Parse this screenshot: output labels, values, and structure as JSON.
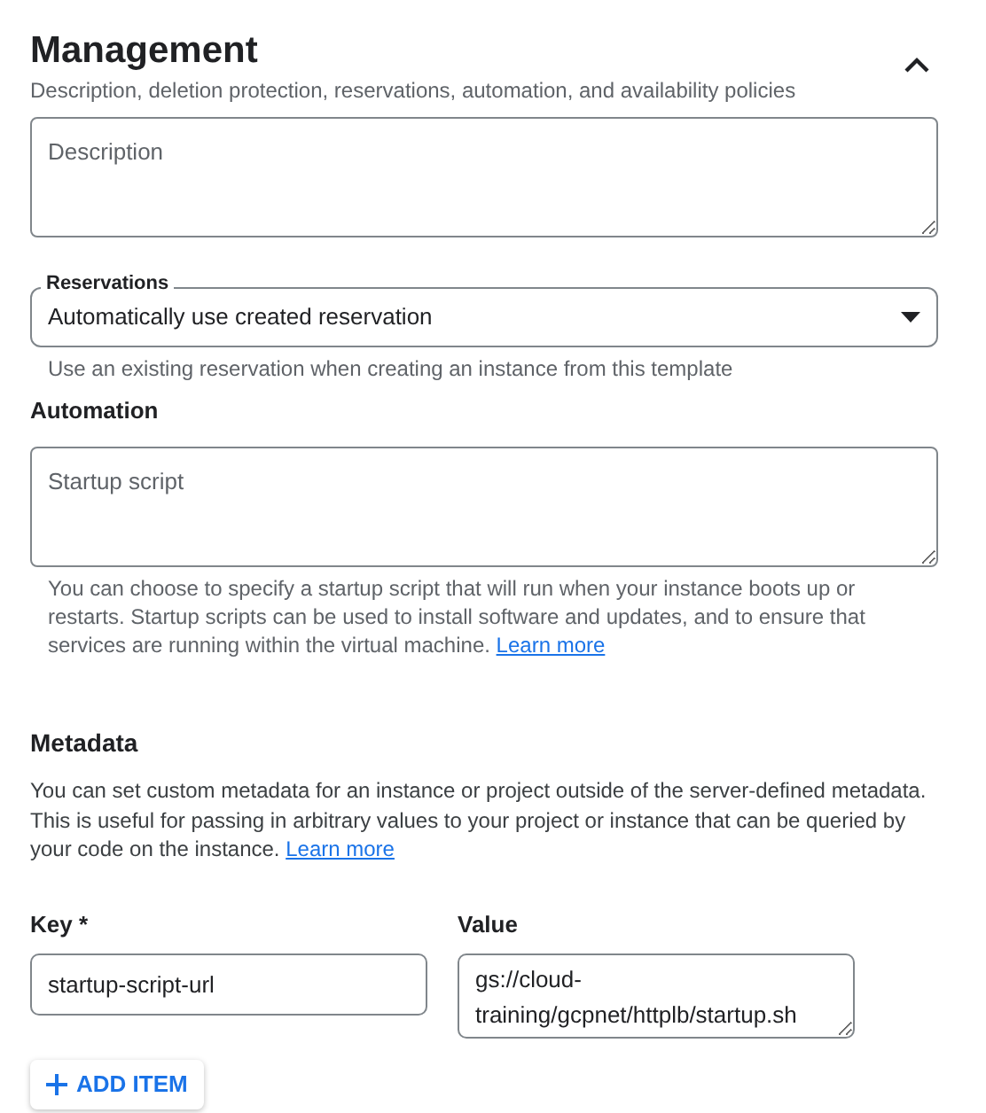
{
  "section": {
    "title": "Management",
    "subtitle": "Description, deletion protection, reservations, automation, and availability policies",
    "expanded": true
  },
  "description_field": {
    "placeholder": "Description"
  },
  "reservations": {
    "label": "Reservations",
    "value": "Automatically use created reservation",
    "helper": "Use an existing reservation when creating an instance from this template"
  },
  "automation": {
    "heading": "Automation",
    "placeholder": "Startup script",
    "helper": "You can choose to specify a startup script that will run when your instance boots up or restarts. Startup scripts can be used to install software and updates, and to ensure that services are running within the virtual machine.",
    "link": "Learn more"
  },
  "metadata": {
    "heading": "Metadata",
    "text": "You can set custom metadata for an instance or project outside of the server-defined metadata. This is useful for passing in arbitrary values to your project or instance that can be queried by your code on the instance.",
    "link": "Learn more",
    "items": [
      {
        "key_label": "Key *",
        "key": "startup-script-url",
        "value_label": "Value",
        "value": "gs://cloud-training/gcpnet/httplb/startup.sh"
      }
    ],
    "add_button": "ADD ITEM"
  }
}
